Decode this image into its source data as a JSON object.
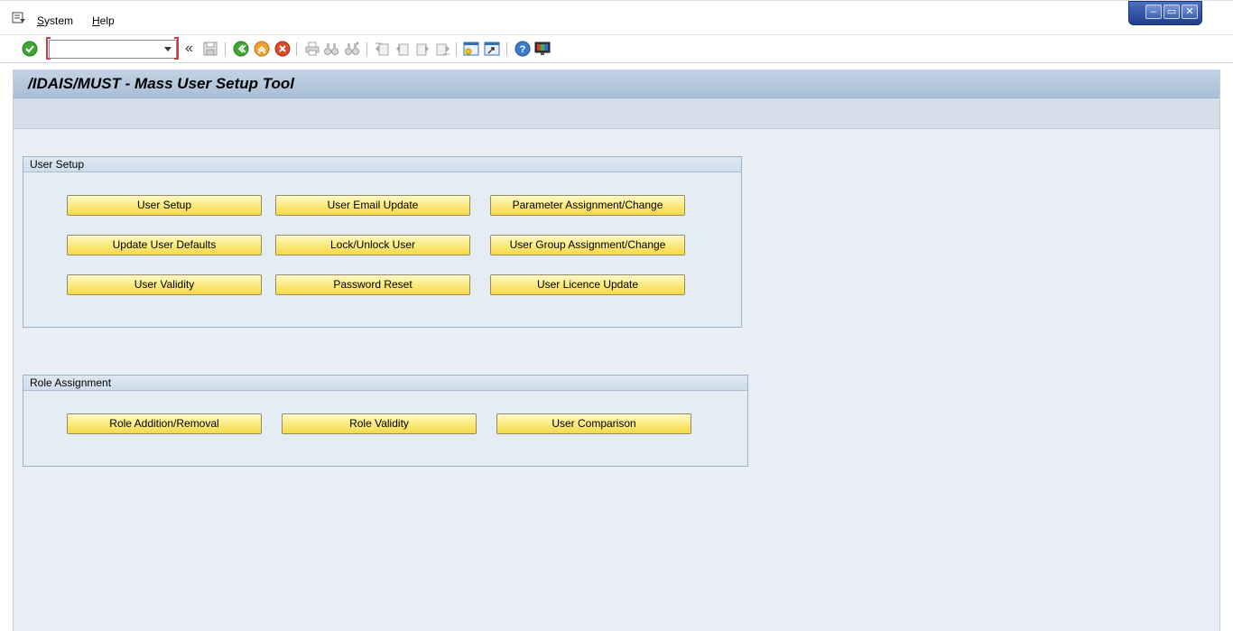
{
  "menu": {
    "system": "System",
    "system_accel": "S",
    "system_rest": "ystem",
    "help": "Help",
    "help_accel": "H",
    "help_rest": "elp"
  },
  "window_controls": {
    "minimize": "–",
    "restore": "▭",
    "close": "✕"
  },
  "toolbar": {
    "command_value": "",
    "back_glyph": "«",
    "icons": [
      "enter-icon",
      "save-icon",
      "back-icon",
      "exit-icon",
      "cancel-icon",
      "print-icon",
      "find-icon",
      "find-next-icon",
      "first-page-icon",
      "previous-page-icon",
      "next-page-icon",
      "last-page-icon",
      "create-session-icon",
      "shortcut-icon",
      "help-icon",
      "customize-layout-icon"
    ]
  },
  "page": {
    "title": "/IDAIS/MUST - Mass User Setup Tool"
  },
  "groups": {
    "user_setup": {
      "title": "User Setup",
      "buttons": [
        "User Setup",
        "User Email Update",
        "Parameter Assignment/Change",
        "Update User Defaults",
        "Lock/Unlock User",
        "User Group Assignment/Change",
        "User Validity",
        "Password Reset",
        "User Licence Update"
      ]
    },
    "role_assignment": {
      "title": "Role Assignment",
      "buttons": [
        "Role Addition/Removal",
        "Role Validity",
        "User Comparison"
      ]
    }
  },
  "colors": {
    "button_yellow": "#fbe97a",
    "frame_bg": "#e9eff5",
    "title_band": "#b6c9dd",
    "enter_green": "#3fa535",
    "exit_orange": "#f0a030",
    "cancel_red": "#d94b2b"
  }
}
